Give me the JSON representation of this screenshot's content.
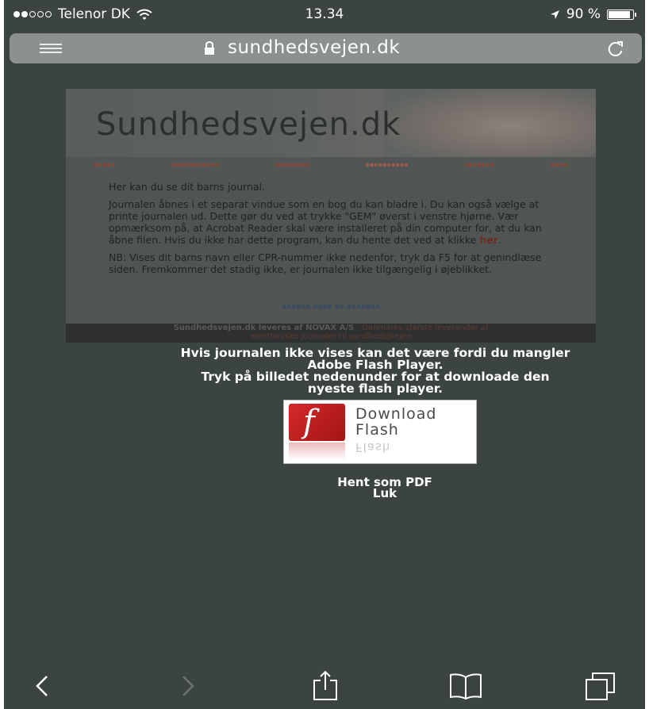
{
  "status_bar": {
    "carrier": "Telenor DK",
    "time": "13.34",
    "battery": "90 %",
    "battery_level": 0.9,
    "signal_bars_filled": 2,
    "signal_bars_total": 5
  },
  "address_bar": {
    "url": "sundhedsvejen.dk"
  },
  "embedded_page": {
    "logo": "Sundhedsvejen.dk",
    "paragraphs": [
      "Her kan du se dit barns journal.",
      "Journalen åbnes i et separat vindue som en bog du kan bladre i. Du kan også vælge at printe journalen ud. Dette gør du ved at trykke \"GEM\" øverst i venstre hjørne. Vær opmærksom på, at Acrobat Reader skal være installeret på din computer for, at du kan åbne filen. Hvis du ikke har dette program, kan du hente det ved at klikke",
      "NB: Vises dit barns navn eller CPR-nummer ikke nedenfor, tryk da F5 for at genindlæse siden. Fremkommer det stadig ikke, er journalen ikke tilgængelig i øjeblikket."
    ],
    "her_link": "her",
    "footer_brand": "Sundhedsvejen.dk leveres af NOVAX A/S",
    "footer_tag": " - Danmarks største leverandør af",
    "footer_line2": "elektroniske journaler til sundhedsplejen"
  },
  "message": {
    "line1": "Hvis journalen ikke vises kan det være fordi du mangler",
    "line2": "Adobe Flash Player.",
    "line3": "Tryk på billedet nedenunder for at downloade den",
    "line4": "nyeste flash player."
  },
  "flash_button": {
    "line1": "Download",
    "line2": "Flash",
    "reflection": "Flash"
  },
  "links": {
    "pdf": "Hent som PDF",
    "close": "Luk"
  },
  "colors": {
    "background": "#3c4440",
    "url_pill": "#8b918e",
    "text": "#ffffff"
  },
  "toolbar_icons": [
    "back-icon",
    "forward-icon",
    "share-icon",
    "bookmarks-icon",
    "tabs-icon"
  ]
}
